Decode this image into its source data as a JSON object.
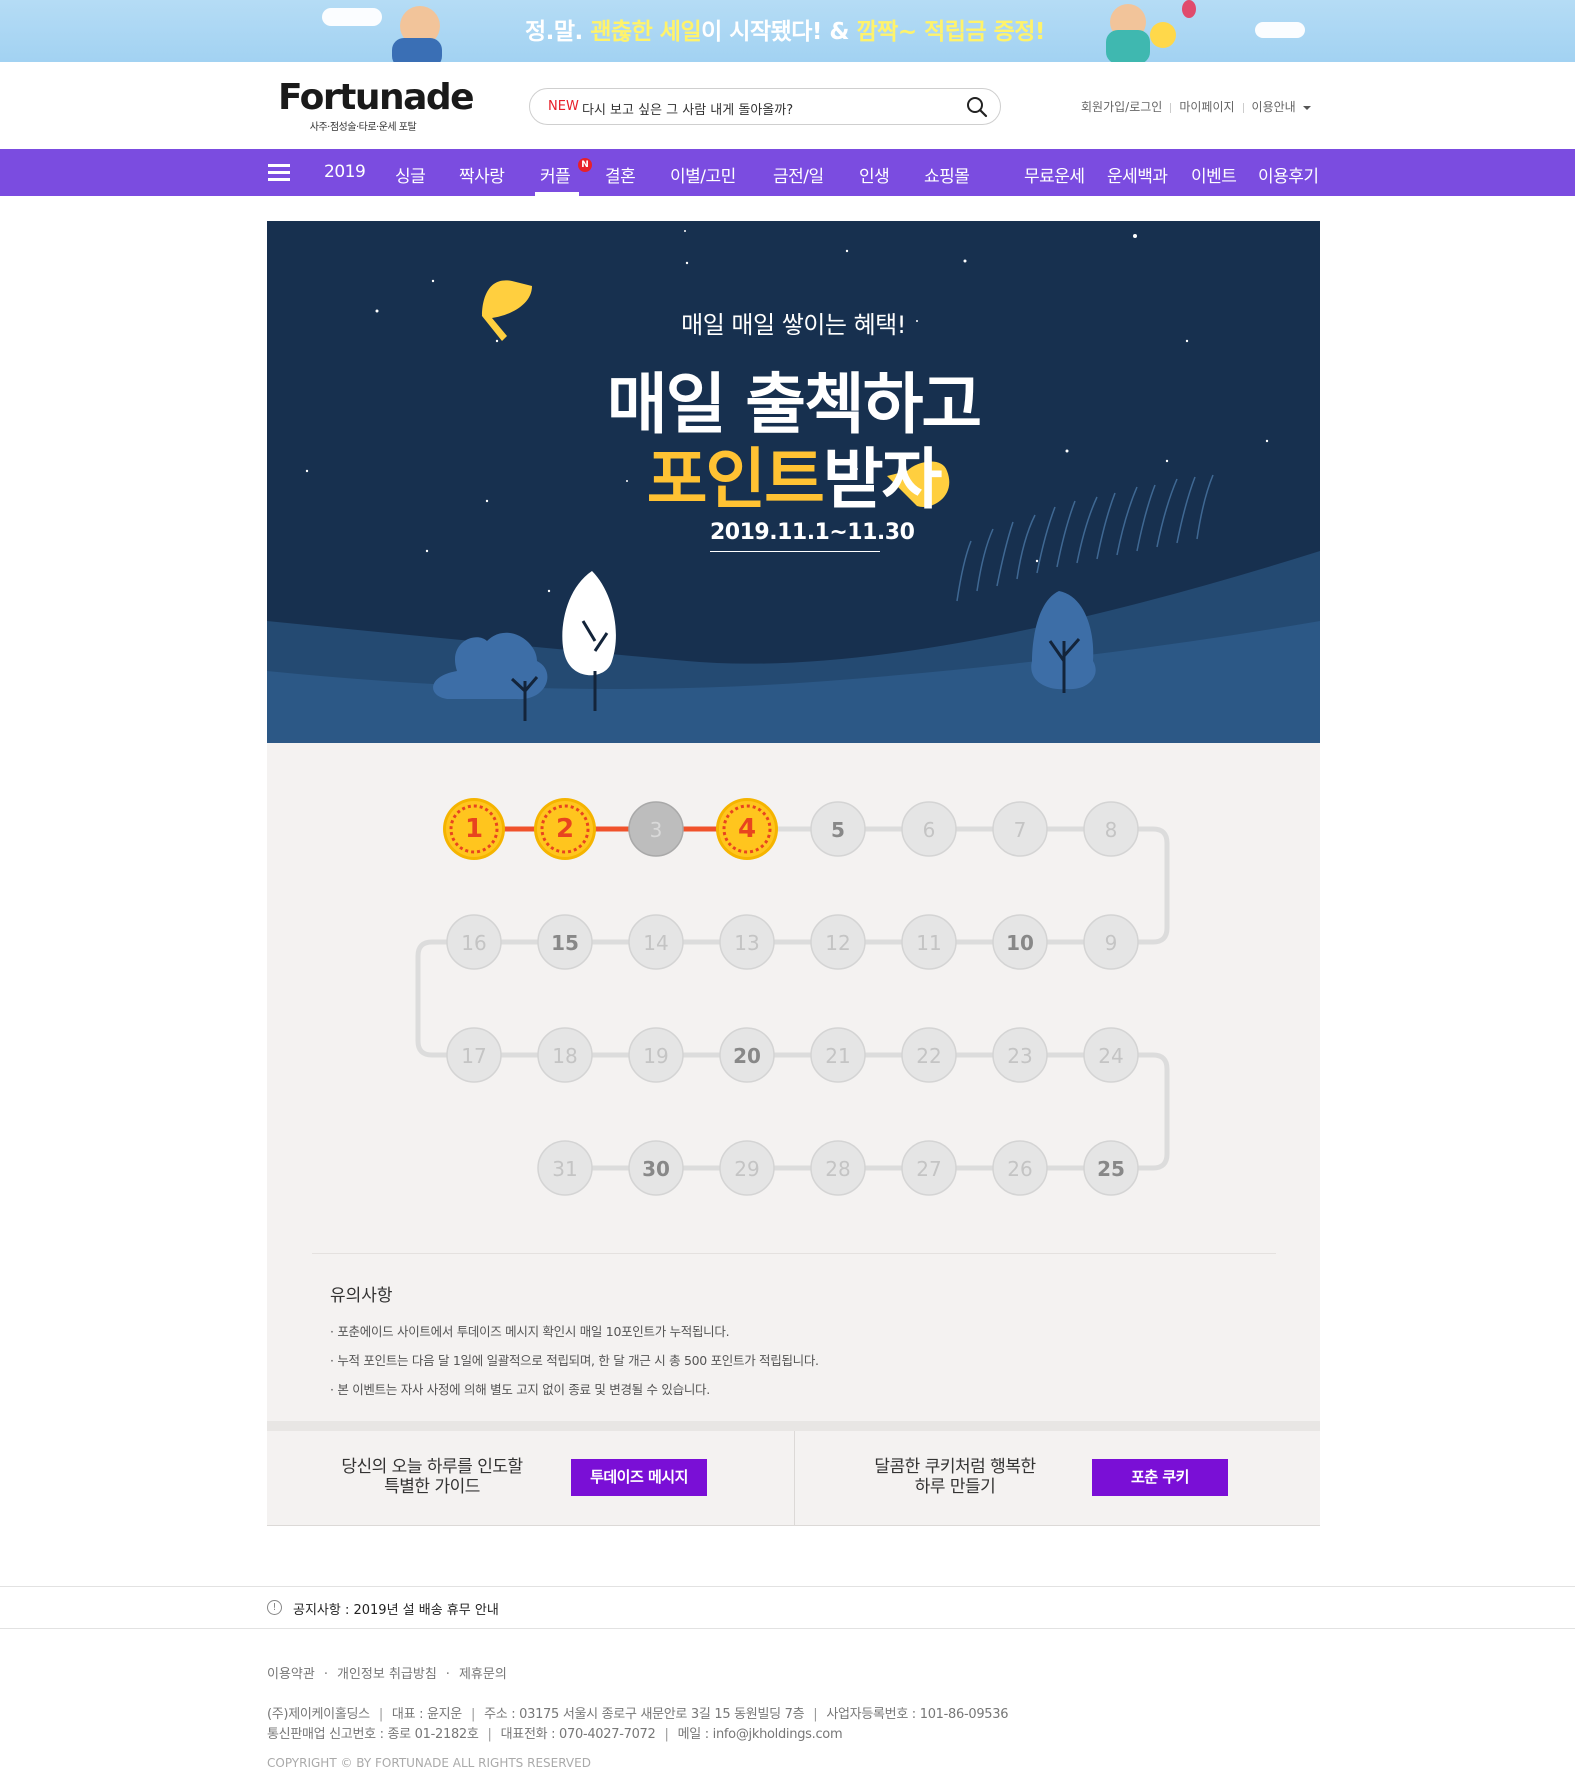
{
  "promo": {
    "text_prefix": "정.말.",
    "text_hl1": "괜춚한 세일",
    "text_mid": "이 시작됐다! &",
    "text_hl2": "깜짝~ 적립금 증정!"
  },
  "header": {
    "logo_title": "Fortunade",
    "logo_sub": "사주·점성술·타로·운세 포탈",
    "search_new": "NEW",
    "search_text": "다시 보고 싶은 그 사람 내게 돌아올까?",
    "util_login": "회원가입/로그인",
    "util_mypage": "마이페이지",
    "util_guide": "이용안내"
  },
  "nav": {
    "items": [
      "2019",
      "싱글",
      "짝사랑",
      "커플",
      "결혼",
      "이별/고민",
      "금전/일",
      "인생",
      "쇼핑몰",
      "무료운세",
      "운세백과",
      "이벤트",
      "이용후기"
    ],
    "badge": "N"
  },
  "hero": {
    "sub": "매일 매일 쌓이는 혜택!",
    "title1": "매일 출첵하고",
    "title2_hl": "포인트",
    "title2_rest": "받자",
    "date": "2019.11.1~11.30"
  },
  "calendar": {
    "checked_days": [
      1,
      2,
      4
    ],
    "missed_days": [
      3
    ],
    "bold_days": [
      5,
      10,
      15,
      20,
      25,
      30
    ],
    "colors": {
      "checked": "#ffc51e",
      "checked_text": "#e8441f",
      "line_active": "#f0522b",
      "missed": "#bdbdbd",
      "default": "#e5e5e5",
      "line": "#dcdcdc"
    }
  },
  "notice": {
    "title": "유의사항",
    "items": [
      "· 포춘에이드 사이트에서 투데이즈 메시지 확인시 매일 10포인트가 누적됩니다.",
      "· 누적 포인트는 다음 달 1일에 일괄적으로 적립되며, 한 달 개근 시 총 500 포인트가 적립됩니다.",
      "· 본 이벤트는 자사 사정에 의해 별도 고지 없이 종료 및 변경될 수 있습니다."
    ]
  },
  "boxes": {
    "left_line1": "당신의 오늘 하루를 인도할",
    "left_line2": "특별한 가이드",
    "left_btn": "투데이즈 메시지",
    "right_line1": "달콤한 쿠키처럼 행복한",
    "right_line2": "하루 만들기",
    "right_btn": "포춘 쿠키"
  },
  "footer": {
    "notice": "공지사항 : 2019년 설 배송 휴무 안내",
    "links": [
      "이용약관",
      "개인정보 취급방침",
      "제휴문의"
    ],
    "info1": [
      "(주)제이케이홀딩스",
      "대표 : 윤지운",
      "주소 : 03175 서울시 종로구 새문안로 3길 15 동원빌딩 7층",
      "사업자등록번호 : 101-86-09536"
    ],
    "info2": [
      "통신판매업 신고번호 : 종로 01-2182호",
      "대표전화 : 070-4027-7072",
      "메일 : info@jkholdings.com"
    ],
    "copyright": "COPYRIGHT © BY FORTUNADE ALL RIGHTS RESERVED"
  }
}
